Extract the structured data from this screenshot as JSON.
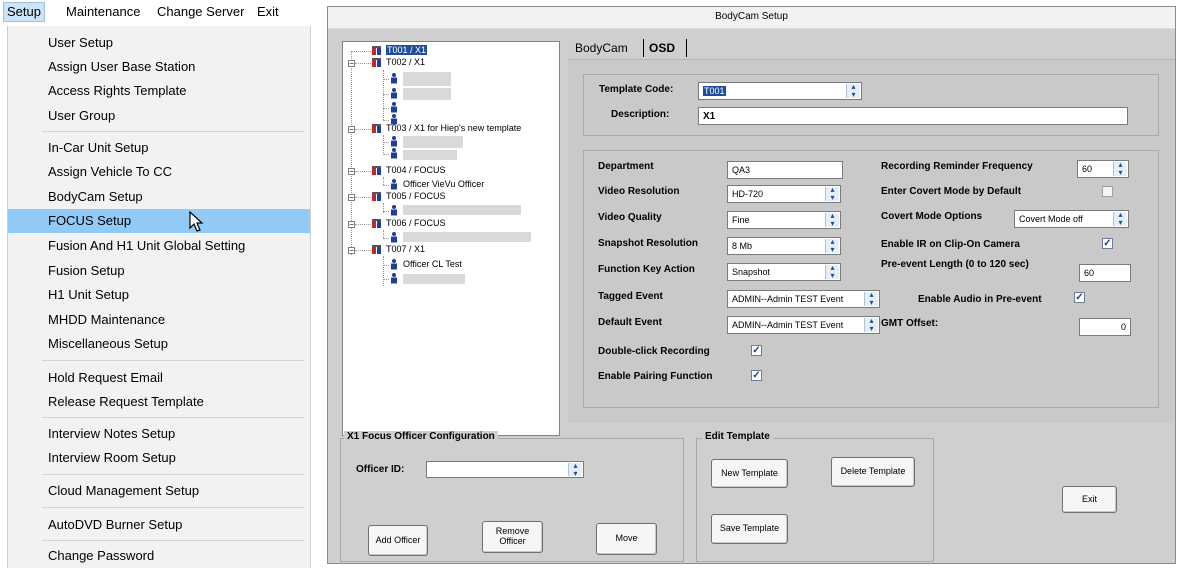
{
  "menubar": {
    "items": [
      "Setup",
      "Maintenance",
      "Change Server",
      "Exit"
    ]
  },
  "menu": {
    "items": [
      "User Setup",
      "Assign User Base Station",
      "Access Rights Template",
      "User Group",
      "In-Car Unit Setup",
      "Assign Vehicle To CC",
      "BodyCam Setup",
      "FOCUS Setup",
      "Fusion And H1 Unit Global Setting",
      "Fusion Setup",
      "H1 Unit Setup",
      "MHDD Maintenance",
      "Miscellaneous Setup",
      "Hold Request Email",
      "Release Request Template",
      "Interview Notes Setup",
      "Interview Room Setup",
      "Cloud Management Setup",
      "AutoDVD Burner Setup",
      "Change Password"
    ],
    "highlighted": "FOCUS Setup"
  },
  "window": {
    "title": "BodyCam Setup"
  },
  "tree": {
    "nodes": [
      "T001 / X1",
      "T002 / X1",
      "T003 / X1 for Hiep's new template",
      "T004 / FOCUS",
      "Officer VieVu Officer",
      "T005 / FOCUS",
      "T006 / FOCUS",
      "T007 / X1",
      "Officer CL Test"
    ]
  },
  "tabs": [
    "BodyCam",
    "OSD"
  ],
  "template": {
    "code_label": "Template Code:",
    "code_value": "T001",
    "desc_label": "Description:",
    "desc_value": "X1"
  },
  "settings": {
    "department_label": "Department",
    "department_value": "QA3",
    "video_res_label": "Video Resolution",
    "video_res_value": "HD-720",
    "video_quality_label": "Video Quality",
    "video_quality_value": "Fine",
    "snapshot_res_label": "Snapshot Resolution",
    "snapshot_res_value": "8 Mb",
    "function_key_label": "Function Key Action",
    "function_key_value": "Snapshot",
    "tagged_event_label": "Tagged Event",
    "tagged_event_value": "ADMIN--Admin TEST Event",
    "default_event_label": "Default Event",
    "default_event_value": "ADMIN--Admin TEST Event",
    "double_click_label": "Double-click Recording",
    "double_click_checked": true,
    "pairing_label": "Enable Pairing Function",
    "pairing_checked": true,
    "reminder_label": "Recording Reminder Frequency",
    "reminder_value": "60",
    "covert_default_label": "Enter Covert Mode by Default",
    "covert_default_checked": false,
    "covert_options_label": "Covert Mode Options",
    "covert_options_value": "Covert Mode off",
    "enable_ir_label": "Enable IR on Clip-On Camera",
    "enable_ir_checked": true,
    "pre_event_label": "Pre-event Length (0 to 120 sec)",
    "pre_event_value": "60",
    "audio_pre_label": "Enable Audio in Pre-event",
    "audio_pre_checked": true,
    "gmt_label": "GMT Offset:",
    "gmt_value": "0"
  },
  "officer_config": {
    "title": "X1 Focus Officer Configuration",
    "officer_id_label": "Officer ID:",
    "officer_id_value": "",
    "add_button": "Add Officer",
    "remove_button_line1": "Remove",
    "remove_button_line2": "Officer",
    "move_button": "Move"
  },
  "edit_template": {
    "title": "Edit Template",
    "new_button": "New Template",
    "delete_button": "Delete Template",
    "save_button": "Save Template"
  },
  "exit_button": "Exit",
  "colors": {
    "highlight": "#91c9f7",
    "tree_selection": "#1f4e9a",
    "check": "#1b3f8f"
  }
}
